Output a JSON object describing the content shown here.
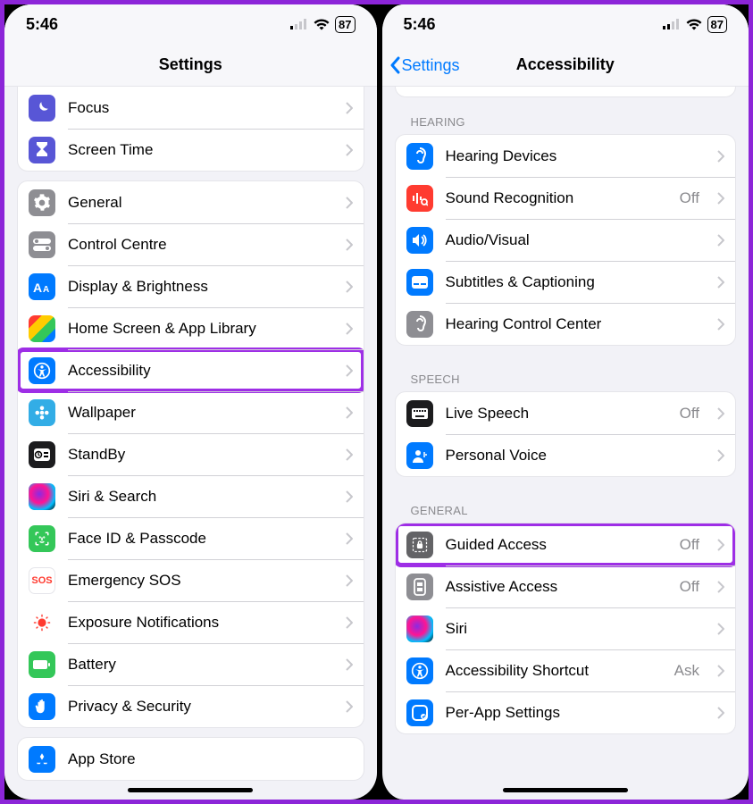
{
  "status": {
    "time": "5:46",
    "battery": "87"
  },
  "left": {
    "title": "Settings",
    "group0": [
      {
        "label": "Focus"
      },
      {
        "label": "Screen Time"
      }
    ],
    "group1": [
      {
        "label": "General"
      },
      {
        "label": "Control Centre"
      },
      {
        "label": "Display & Brightness"
      },
      {
        "label": "Home Screen & App Library"
      },
      {
        "label": "Accessibility",
        "highlight": true
      },
      {
        "label": "Wallpaper"
      },
      {
        "label": "StandBy"
      },
      {
        "label": "Siri & Search"
      },
      {
        "label": "Face ID & Passcode"
      },
      {
        "label": "Emergency SOS"
      },
      {
        "label": "Exposure Notifications"
      },
      {
        "label": "Battery"
      },
      {
        "label": "Privacy & Security"
      }
    ],
    "group2": [
      {
        "label": "App Store"
      }
    ]
  },
  "right": {
    "back": "Settings",
    "title": "Accessibility",
    "hearing_header": "HEARING",
    "hearing": [
      {
        "label": "Hearing Devices",
        "value": ""
      },
      {
        "label": "Sound Recognition",
        "value": "Off"
      },
      {
        "label": "Audio/Visual",
        "value": ""
      },
      {
        "label": "Subtitles & Captioning",
        "value": ""
      },
      {
        "label": "Hearing Control Center",
        "value": ""
      }
    ],
    "speech_header": "SPEECH",
    "speech": [
      {
        "label": "Live Speech",
        "value": "Off"
      },
      {
        "label": "Personal Voice",
        "value": ""
      }
    ],
    "general_header": "GENERAL",
    "general": [
      {
        "label": "Guided Access",
        "value": "Off",
        "highlight": true
      },
      {
        "label": "Assistive Access",
        "value": "Off"
      },
      {
        "label": "Siri",
        "value": ""
      },
      {
        "label": "Accessibility Shortcut",
        "value": "Ask"
      },
      {
        "label": "Per-App Settings",
        "value": ""
      }
    ]
  }
}
